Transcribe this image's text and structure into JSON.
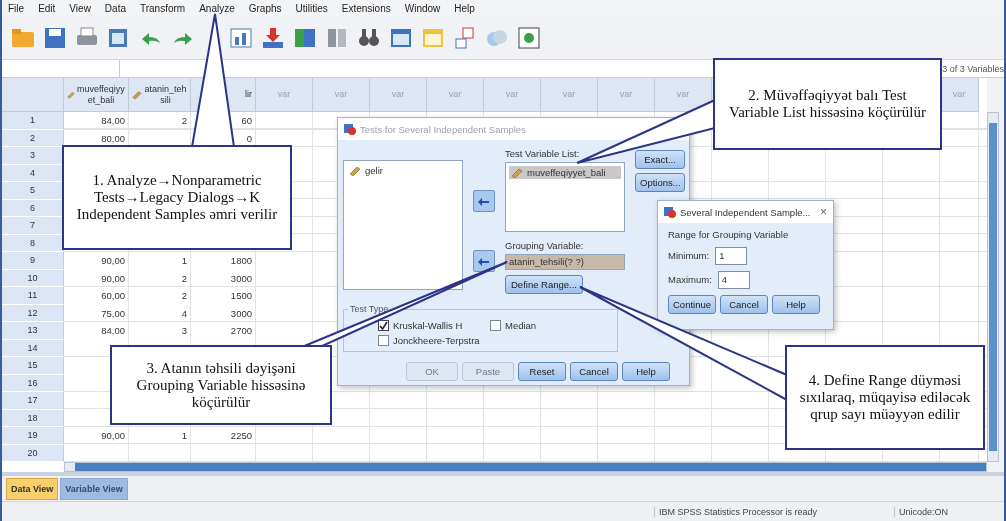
{
  "menu": [
    "File",
    "Edit",
    "View",
    "Data",
    "Transform",
    "Analyze",
    "Graphs",
    "Utilities",
    "Extensions",
    "Window",
    "Help"
  ],
  "formula_bar": {
    "variable_count": "3 of 3 Variables"
  },
  "grid": {
    "columns": [
      {
        "label": "muveffeqiyyet_bali",
        "kind": "variable"
      },
      {
        "label": "atanin_tehsili",
        "kind": "variable"
      },
      {
        "label": "lir",
        "kind": "plain"
      },
      {
        "label": "var",
        "kind": "placeholder"
      },
      {
        "label": "var",
        "kind": "placeholder"
      },
      {
        "label": "var",
        "kind": "placeholder"
      },
      {
        "label": "var",
        "kind": "placeholder"
      },
      {
        "label": "var",
        "kind": "placeholder"
      },
      {
        "label": "var",
        "kind": "placeholder"
      },
      {
        "label": "var",
        "kind": "placeholder"
      },
      {
        "label": "var",
        "kind": "placeholder"
      },
      {
        "kind": "placeholder"
      },
      {
        "kind": "placeholder"
      },
      {
        "kind": "placeholder"
      },
      {
        "kind": "placeholder"
      },
      {
        "label": "var",
        "kind": "placeholder"
      }
    ],
    "rows": [
      {
        "number": "1",
        "cells": [
          "84,00",
          "2",
          "60"
        ]
      },
      {
        "number": "2",
        "cells": [
          "80,00",
          null,
          "0"
        ]
      },
      {
        "number": "3"
      },
      {
        "number": "4"
      },
      {
        "number": "5"
      },
      {
        "number": "6"
      },
      {
        "number": "7"
      },
      {
        "number": "8"
      },
      {
        "number": "9",
        "cells": [
          "90,00",
          "1",
          "1800"
        ]
      },
      {
        "number": "10",
        "cells": [
          "90,00",
          "2",
          "3000"
        ]
      },
      {
        "number": "11",
        "cells": [
          "60,00",
          "2",
          "1500"
        ]
      },
      {
        "number": "12",
        "cells": [
          "75,00",
          "4",
          "3000"
        ]
      },
      {
        "number": "13",
        "cells": [
          "84,00",
          "3",
          "2700"
        ]
      },
      {
        "number": "14"
      },
      {
        "number": "15"
      },
      {
        "number": "16"
      },
      {
        "number": "17"
      },
      {
        "number": "18"
      },
      {
        "number": "19",
        "cells": [
          "90,00",
          "1",
          "2250"
        ]
      },
      {
        "number": "20"
      }
    ]
  },
  "tabs": [
    {
      "label": "Data View",
      "selected": true
    },
    {
      "label": "Variable View",
      "selected": false
    }
  ],
  "status_bar": {
    "processor": "IBM SPSS Statistics Processor is ready",
    "encoding": "Unicode:ON"
  },
  "main_dialog": {
    "title": "Tests for Several Independent Samples",
    "source_list": [
      {
        "name": "gelir",
        "selected": false
      }
    ],
    "test_variable_label": "Test Variable List:",
    "test_variables": [
      {
        "name": "muveffeqiyyet_bali",
        "selected": true
      }
    ],
    "grouping_label": "Grouping Variable:",
    "grouping_value": "atanin_tehsili(? ?)",
    "define_range": "Define Range...",
    "side_buttons": [
      "Exact...",
      "Options..."
    ],
    "test_type": {
      "title": "Test Type",
      "options": [
        {
          "label": "Kruskal-Wallis H",
          "checked": true
        },
        {
          "label": "Median",
          "checked": false
        },
        {
          "label": "Jonckheere-Terpstra",
          "checked": false
        }
      ]
    },
    "buttons": [
      {
        "label": "OK",
        "disabled": true
      },
      {
        "label": "Paste",
        "disabled": true
      },
      {
        "label": "Reset",
        "disabled": false
      },
      {
        "label": "Cancel",
        "disabled": false
      },
      {
        "label": "Help",
        "disabled": false
      }
    ]
  },
  "range_dialog": {
    "title": "Several Independent Sample...",
    "close": "×",
    "heading": "Range for Grouping Variable",
    "minimum_label": "Minimum:",
    "minimum": "1",
    "maximum_label": "Maximum:",
    "maximum": "4",
    "buttons": [
      "Continue",
      "Cancel",
      "Help"
    ]
  },
  "callouts": [
    {
      "text": "1. Analyze→Nonparametric Tests→Legacy Dialogs→K Independent Samples əmri verilir"
    },
    {
      "text": "2. Müvəffəqiyyət balı Test Variable List hissəsinə köçürülür"
    },
    {
      "text": "3. Atanın təhsili dəyişəni Grouping Variable hissəsinə köçürülür"
    },
    {
      "text": "4. Define Range düyməsi sıxılaraq, müqayisə ediləcək qrup sayı müəyyən edilir"
    }
  ]
}
